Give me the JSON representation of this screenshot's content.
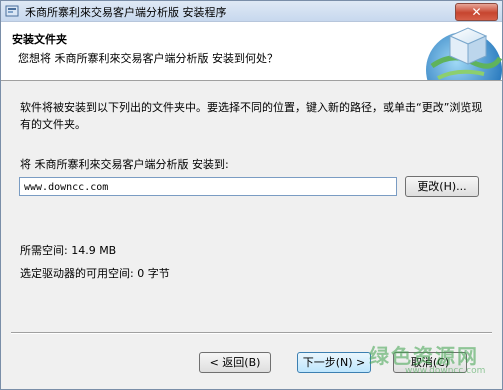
{
  "window": {
    "title": "禾商所寨利來交易客户端分析版 安装程序",
    "close_label": "✕"
  },
  "header": {
    "title": "安装文件夹",
    "subtitle": "您想将 禾商所寨利來交易客户端分析版 安装到何处？",
    "icon": "install-cube-globe-icon"
  },
  "main": {
    "description": "软件将被安装到以下列出的文件夹中。要选择不同的位置，键入新的路径，或单击“更改”浏览现有的文件夹。",
    "path_label": "将 禾商所寨利來交易客户端分析版 安装到:",
    "path_value": "www.downcc.com",
    "change_button": "更改(H)...",
    "space_required": "所需空间: 14.9 MB",
    "space_available": "选定驱动器的可用空间: 0 字节"
  },
  "footer": {
    "back_button": "< 返回(B)",
    "next_button": "下一步(N) >",
    "cancel_button": "取消(C)"
  },
  "watermark": {
    "text": "绿色资源网",
    "url": "www.downcc.com"
  },
  "colors": {
    "title_gradient_top": "#dfe9f5",
    "close_red": "#c7452f",
    "primary_button_border": "#3c7fb1",
    "watermark_green": "#3fa34d"
  }
}
